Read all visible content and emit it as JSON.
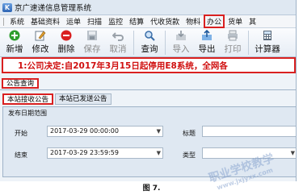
{
  "window": {
    "icon_letter": "K",
    "title": "京广速递信息管理系统"
  },
  "menu": [
    {
      "label": "系统",
      "active": false
    },
    {
      "label": "基础资料",
      "active": false
    },
    {
      "label": "运单",
      "active": false
    },
    {
      "label": "扫描",
      "active": false
    },
    {
      "label": "监控",
      "active": false
    },
    {
      "label": "结算",
      "active": false
    },
    {
      "label": "代收货款",
      "active": false
    },
    {
      "label": "物料",
      "active": false
    },
    {
      "label": "办公",
      "active": true
    },
    {
      "label": "货单",
      "active": false
    },
    {
      "label": "其",
      "active": false
    }
  ],
  "toolbar": {
    "new": "新增",
    "edit": "修改",
    "delete": "删除",
    "save": "保存",
    "cancel": "取消",
    "query": "查询",
    "import": "导入",
    "export": "导出",
    "print": "打印",
    "calc": "计算器"
  },
  "announcement": "1:公司决定:自2017年3月15日起停用E8系统，全网各",
  "section_tab": "公告查询",
  "subtabs": {
    "received": "本站接收公告",
    "sent": "本站已发送公告"
  },
  "filter": {
    "legend": "发布日期范围",
    "start_label": "开始",
    "start_value": "2017-03-29 00:00:00",
    "end_label": "结束",
    "end_value": "2017-03-29 23:59:59",
    "title_label": "标题",
    "type_label": "类型"
  },
  "watermark": {
    "text": "职业学校教学",
    "sub": "www.jxjyxx.com"
  },
  "caption": "图 7."
}
